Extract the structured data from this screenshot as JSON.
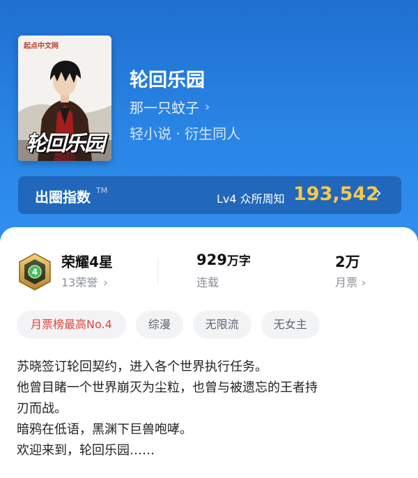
{
  "book": {
    "title": "轮回乐园",
    "author": "那一只蚊子",
    "genre": "轻小说 · 衍生同人",
    "cover": {
      "publisher": "起点中文网",
      "title": "轮回乐园",
      "author": "那一只蚊子"
    }
  },
  "index": {
    "label": "出圈指数",
    "tm": "TM",
    "level": "Lv4 众所周知",
    "value": "193,542"
  },
  "stats": {
    "honor": {
      "title": "荣耀4星",
      "sub": "13荣誉",
      "badge_number": "4"
    },
    "words": {
      "num": "929",
      "unit": "万字",
      "sub": "连载"
    },
    "votes": {
      "num": "2万",
      "sub": "月票"
    }
  },
  "tags": [
    "月票榜最高No.4",
    "综漫",
    "无限流",
    "无女主"
  ],
  "description": [
    "苏晓签订轮回契约，进入各个世界执行任务。",
    "他曾目睹一个世界崩灭为尘粒，也曾与被遗忘的王者持",
    "刃而战。",
    "暗鸦在低语，黑渊下巨兽咆哮。",
    "欢迎来到，轮回乐园……"
  ],
  "icons": {
    "chevron": "›",
    "badge": "gold-hexagon-badge-icon"
  },
  "colors": {
    "header_blue": "#2a86e6",
    "index_gold": "#f7c948",
    "tag_red": "#e0453a"
  }
}
